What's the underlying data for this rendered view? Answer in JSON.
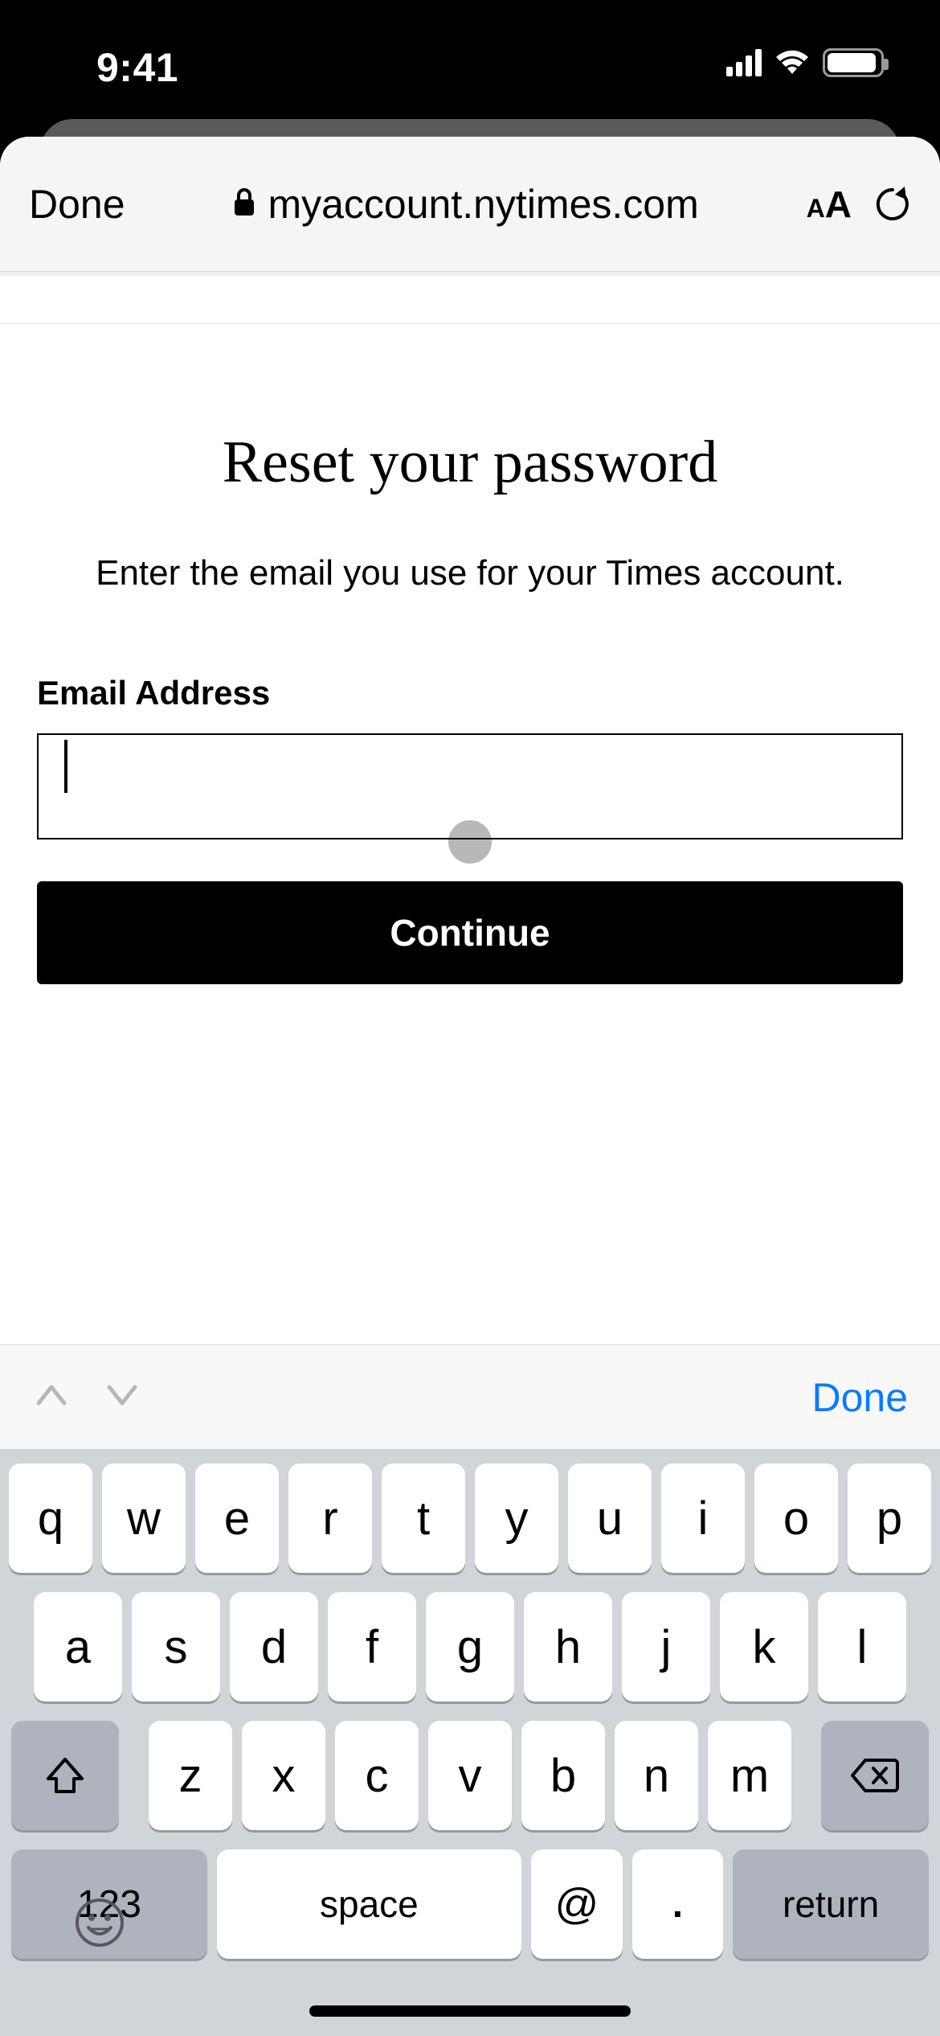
{
  "status": {
    "time": "9:41"
  },
  "safari": {
    "done": "Done",
    "url": "myaccount.nytimes.com",
    "aa_small": "A",
    "aa_big": "A"
  },
  "page": {
    "heading": "Reset your password",
    "subheading": "Enter the email you use for your Times account.",
    "email_label": "Email Address",
    "email_value": "",
    "continue": "Continue"
  },
  "kbd": {
    "accessoryDone": "Done",
    "row1": [
      "q",
      "w",
      "e",
      "r",
      "t",
      "y",
      "u",
      "i",
      "o",
      "p"
    ],
    "row2": [
      "a",
      "s",
      "d",
      "f",
      "g",
      "h",
      "j",
      "k",
      "l"
    ],
    "row3": [
      "z",
      "x",
      "c",
      "v",
      "b",
      "n",
      "m"
    ],
    "k123": "123",
    "space": "space",
    "at": "@",
    "dot": ".",
    "return": "return"
  }
}
